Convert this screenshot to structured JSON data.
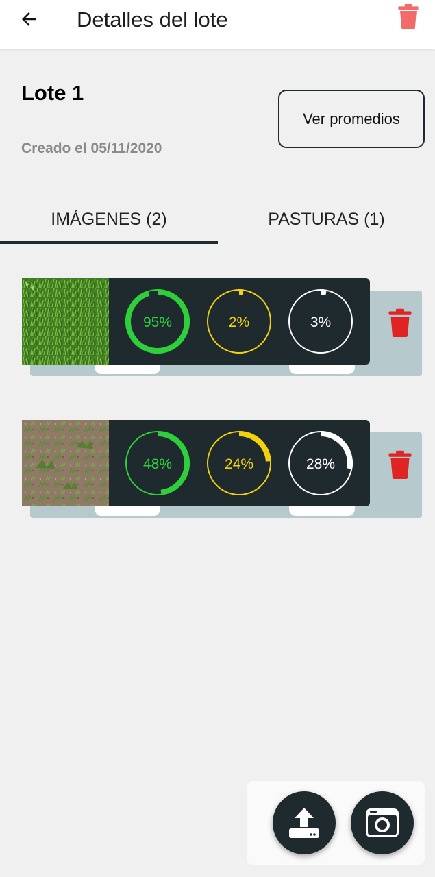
{
  "header": {
    "title": "Detalles del lote",
    "back_icon": "arrow-left-icon",
    "delete_icon": "trash-icon",
    "delete_color": "#f26b6b"
  },
  "lote": {
    "name": "Lote 1",
    "created": "Creado el 05/11/2020",
    "averages_button": "Ver promedios"
  },
  "tabs": [
    {
      "label": "IMÁGENES (2)",
      "active": true
    },
    {
      "label": "PASTURAS (1)",
      "active": false
    }
  ],
  "colors": {
    "green": "#2fcf3c",
    "yellow": "#f2d20c",
    "white": "#ffffff",
    "dark": "#1f2a2e",
    "card_back": "#b6c9cd",
    "trash_red": "#e02424"
  },
  "images": [
    {
      "thumbnail": "dense green grass",
      "metrics": [
        {
          "label": "95%",
          "value": 95,
          "color": "green"
        },
        {
          "label": "2%",
          "value": 2,
          "color": "yellow"
        },
        {
          "label": "3%",
          "value": 3,
          "color": "white"
        }
      ]
    },
    {
      "thumbnail": "sparse grass on soil",
      "metrics": [
        {
          "label": "48%",
          "value": 48,
          "color": "green"
        },
        {
          "label": "24%",
          "value": 24,
          "color": "yellow"
        },
        {
          "label": "28%",
          "value": 28,
          "color": "white"
        }
      ]
    }
  ],
  "actions": {
    "upload_icon": "upload-icon",
    "camera_icon": "camera-icon"
  }
}
